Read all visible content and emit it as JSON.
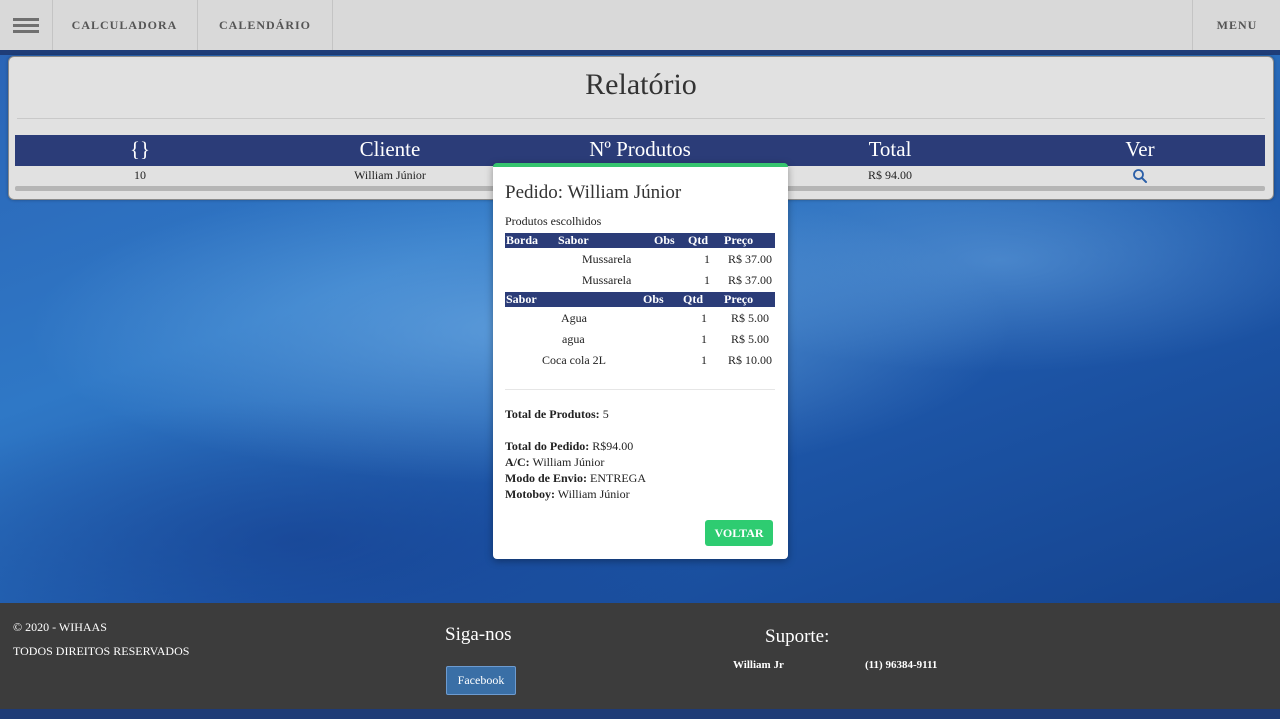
{
  "nav": {
    "calculadora": "CALCULADORA",
    "calendario": "CALENDÁRIO",
    "menu": "MENU"
  },
  "report": {
    "title": "Relatório",
    "columns": [
      "{}",
      "Cliente",
      "Nº Produtos",
      "Total",
      "Ver"
    ],
    "rows": [
      {
        "id": "10",
        "cliente": "William Júnior",
        "produtos": "",
        "total": "R$ 94.00",
        "ver_icon": "search-icon"
      }
    ]
  },
  "modal": {
    "title": "Pedido: William Júnior",
    "subtitle": "Produtos escolhidos",
    "pizza_headers": [
      "Borda",
      "Sabor",
      "Obs",
      "Qtd",
      "Preço"
    ],
    "pizza_rows": [
      {
        "borda": "",
        "sabor": "Mussarela",
        "obs": "",
        "qtd": "1",
        "preco": "R$ 37.00"
      },
      {
        "borda": "",
        "sabor": "Mussarela",
        "obs": "",
        "qtd": "1",
        "preco": "R$ 37.00"
      }
    ],
    "drink_headers": [
      "Sabor",
      "Obs",
      "Qtd",
      "Preço"
    ],
    "drink_rows": [
      {
        "sabor": "Agua",
        "obs": "",
        "qtd": "1",
        "preco": "R$ 5.00"
      },
      {
        "sabor": "agua",
        "obs": "",
        "qtd": "1",
        "preco": "R$ 5.00"
      },
      {
        "sabor": "Coca cola 2L",
        "obs": "",
        "qtd": "1",
        "preco": "R$ 10.00"
      }
    ],
    "total_produtos_label": "Total de Produtos:",
    "total_produtos_value": "5",
    "total_pedido_label": "Total do Pedido:",
    "total_pedido_value": "R$94.00",
    "ac_label": "A/C:",
    "ac_value": "William Júnior",
    "envio_label": "Modo de Envio:",
    "envio_value": "ENTREGA",
    "motoboy_label": "Motoboy:",
    "motoboy_value": "William Júnior",
    "button": "VOLTAR"
  },
  "footer": {
    "copyright": "© 2020 - WIHAAS",
    "rights": "TODOS DIREITOS RESERVADOS",
    "follow_title": "Siga-nos",
    "facebook": "Facebook",
    "support_title": "Suporte:",
    "support_name": "William Jr",
    "support_phone": "(11) 96384-9111"
  },
  "colors": {
    "header_blue": "#2b3c78",
    "accent_green": "#2ecc71",
    "footer_bg": "#3c3c3c"
  }
}
